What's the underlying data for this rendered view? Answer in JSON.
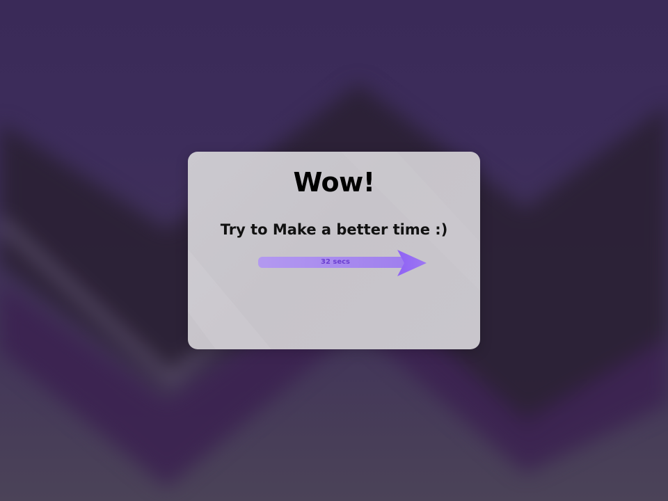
{
  "dialog": {
    "title": "Wow!",
    "message": "Try to Make a better time :)",
    "time_label": "32 secs"
  },
  "colors": {
    "background_top": "#3a2a58",
    "background_bottom": "#4b4358",
    "zigzag_dark": "#2a2033",
    "zigzag_purple": "#3b2150",
    "dialog_background": "#c9c6cc",
    "arrow_shaft": "#a484ee",
    "arrow_head": "#8a5cf0",
    "time_label": "#6a3fcf"
  },
  "icons": {
    "time_indicator": "right-arrow-icon"
  }
}
